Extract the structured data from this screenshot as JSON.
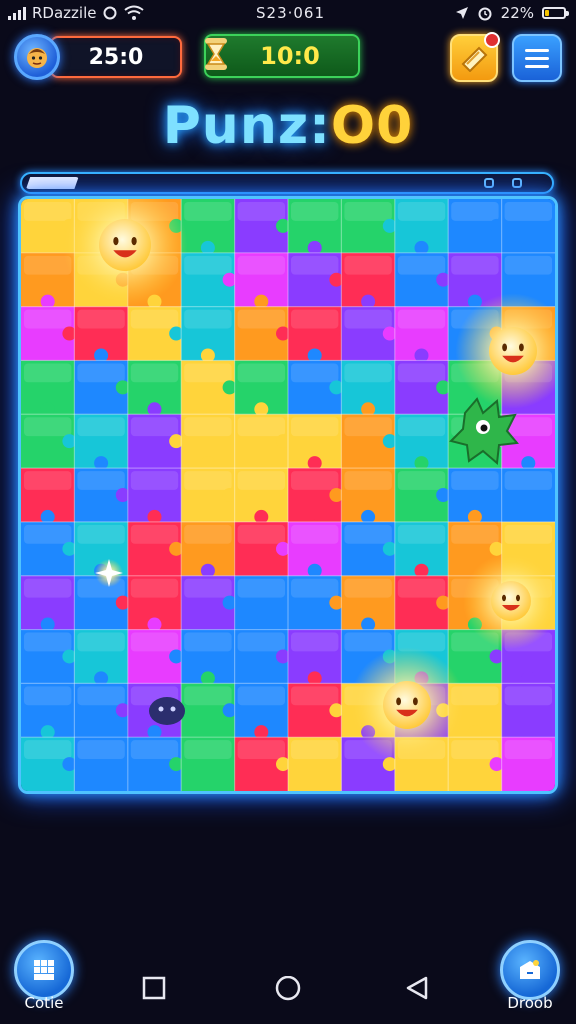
{
  "status_bar": {
    "carrier": "RDazzile",
    "time": "S23·061",
    "battery": "22%",
    "battery_level": 0.22,
    "icons": [
      "signal-icon",
      "sync-icon",
      "wifi-icon",
      "location-icon",
      "alarm-icon",
      "battery-icon"
    ]
  },
  "hud": {
    "score": "25:0",
    "timer": "10:0",
    "avatar_icon": "player-avatar-icon",
    "hint_icon": "hint-card-icon",
    "menu_icon": "menu-icon"
  },
  "title": {
    "text": "Punz:",
    "number": "O0"
  },
  "progress": {
    "level": 0.1
  },
  "board": {
    "cols": 10,
    "rows": 11,
    "colors": {
      "yellow": "#ffd43b",
      "orange": "#ff9a1f",
      "green": "#25d36a",
      "blue": "#1e88ff",
      "purple": "#8a3cff",
      "red": "#ff2d55",
      "magenta": "#e83cff",
      "teal": "#17c6d8"
    },
    "grid": [
      [
        "yellow",
        "yellow",
        "orange",
        "green",
        "purple",
        "green",
        "green",
        "teal",
        "blue",
        "blue"
      ],
      [
        "orange",
        "yellow",
        "orange",
        "teal",
        "magenta",
        "purple",
        "red",
        "blue",
        "purple",
        "blue"
      ],
      [
        "magenta",
        "red",
        "yellow",
        "teal",
        "orange",
        "red",
        "purple",
        "magenta",
        "blue",
        "orange"
      ],
      [
        "green",
        "blue",
        "green",
        "yellow",
        "green",
        "blue",
        "teal",
        "purple",
        "green",
        "purple"
      ],
      [
        "green",
        "teal",
        "purple",
        "yellow",
        "yellow",
        "yellow",
        "orange",
        "teal",
        "green",
        "magenta"
      ],
      [
        "red",
        "blue",
        "purple",
        "yellow",
        "yellow",
        "red",
        "orange",
        "green",
        "blue",
        "blue"
      ],
      [
        "blue",
        "teal",
        "red",
        "orange",
        "red",
        "magenta",
        "blue",
        "teal",
        "orange",
        "yellow"
      ],
      [
        "purple",
        "blue",
        "red",
        "purple",
        "blue",
        "blue",
        "orange",
        "red",
        "orange",
        "yellow"
      ],
      [
        "blue",
        "teal",
        "magenta",
        "blue",
        "blue",
        "purple",
        "blue",
        "teal",
        "green",
        "purple"
      ],
      [
        "blue",
        "blue",
        "purple",
        "green",
        "blue",
        "red",
        "yellow",
        "purple",
        "yellow",
        "purple"
      ],
      [
        "teal",
        "blue",
        "blue",
        "green",
        "red",
        "yellow",
        "purple",
        "yellow",
        "yellow",
        "magenta"
      ]
    ],
    "characters": [
      "sun-smiley-icon",
      "sun-smiley-icon",
      "sun-smiley-icon",
      "sun-smiley-icon",
      "green-monster-icon",
      "dark-blob-icon"
    ]
  },
  "bottom": {
    "left_label": "Cotie",
    "right_label": "Droob",
    "left_icon": "collection-grid-icon",
    "right_icon": "drop-box-icon",
    "nav": [
      "square-nav-icon",
      "home-circle-nav-icon",
      "back-triangle-nav-icon"
    ]
  }
}
